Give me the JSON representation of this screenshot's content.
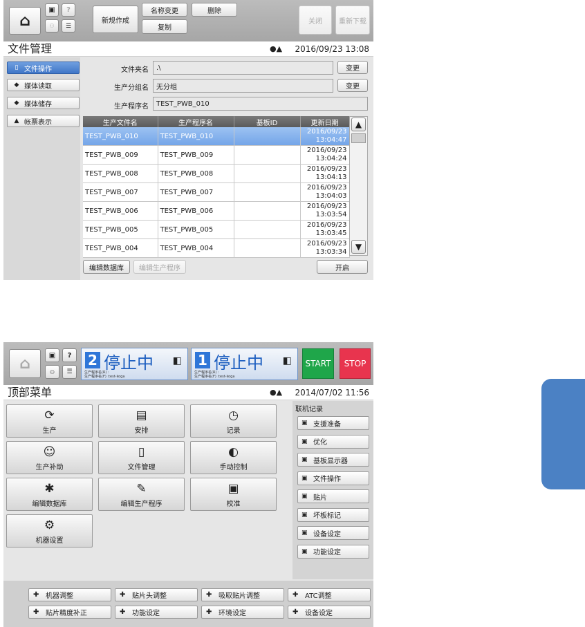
{
  "top": {
    "toolbar": {
      "new_label": "新规作成",
      "rename_label": "名称变更",
      "delete_label": "删除",
      "copy_label": "复制",
      "close_label": "关闭",
      "reload_label": "重新下载",
      "help_glyph": "?"
    },
    "title": "文件管理",
    "datetime": "2016/09/23 13:08",
    "sidebar": [
      {
        "label": "文件操作",
        "icon": "file-op-icon",
        "active": true
      },
      {
        "label": "媒体读取",
        "icon": "media-read-icon",
        "active": false
      },
      {
        "label": "媒体储存",
        "icon": "media-save-icon",
        "active": false
      },
      {
        "label": "帐票表示",
        "icon": "report-icon",
        "active": false
      }
    ],
    "fields": {
      "folder_label": "文件夹名",
      "folder_value": ".\\",
      "group_label": "生产分组名",
      "group_value": "无分组",
      "program_label": "生产程序名",
      "program_value": "TEST_PWB_010",
      "change_label": "变更"
    },
    "table": {
      "headers": [
        "生产文件名",
        "生产程序名",
        "基板ID",
        "更新日期"
      ],
      "rows": [
        {
          "file": "TEST_PWB_010",
          "program": "TEST_PWB_010",
          "board": "",
          "date": "2016/09/23",
          "time": "13:04:47"
        },
        {
          "file": "TEST_PWB_009",
          "program": "TEST_PWB_009",
          "board": "",
          "date": "2016/09/23",
          "time": "13:04:24"
        },
        {
          "file": "TEST_PWB_008",
          "program": "TEST_PWB_008",
          "board": "",
          "date": "2016/09/23",
          "time": "13:04:13"
        },
        {
          "file": "TEST_PWB_007",
          "program": "TEST_PWB_007",
          "board": "",
          "date": "2016/09/23",
          "time": "13:04:03"
        },
        {
          "file": "TEST_PWB_006",
          "program": "TEST_PWB_006",
          "board": "",
          "date": "2016/09/23",
          "time": "13:03:54"
        },
        {
          "file": "TEST_PWB_005",
          "program": "TEST_PWB_005",
          "board": "",
          "date": "2016/09/23",
          "time": "13:03:45"
        },
        {
          "file": "TEST_PWB_004",
          "program": "TEST_PWB_004",
          "board": "",
          "date": "2016/09/23",
          "time": "13:03:34"
        }
      ]
    },
    "bottom_buttons": {
      "edit_db": "编辑数据库",
      "edit_program": "编辑生产程序",
      "open": "开启"
    }
  },
  "bottom": {
    "status": [
      {
        "num": "2",
        "text": "停止中",
        "sub1": "生产程序名(R) :",
        "sub2": "生产程序名(F) :test-koga"
      },
      {
        "num": "1",
        "text": "停止中",
        "sub1": "生产程序名(R) :",
        "sub2": "生产程序名(F) :test-koga"
      }
    ],
    "start_label": "START",
    "stop_label": "STOP",
    "help_glyph": "?",
    "title": "顶部菜单",
    "datetime": "2014/07/02 11:56",
    "menu": [
      {
        "label": "生产",
        "icon": "auto-icon",
        "glyph": "⟳"
      },
      {
        "label": "安排",
        "icon": "schedule-icon",
        "glyph": "▤"
      },
      {
        "label": "记录",
        "icon": "history-icon",
        "glyph": "◷"
      },
      {
        "label": "生产补助",
        "icon": "support-icon",
        "glyph": "☺"
      },
      {
        "label": "文件管理",
        "icon": "file-icon",
        "glyph": "▯"
      },
      {
        "label": "手动控制",
        "icon": "manual-icon",
        "glyph": "◐"
      },
      {
        "label": "编辑数据库",
        "icon": "database-icon",
        "glyph": "✱"
      },
      {
        "label": "编辑生产程序",
        "icon": "program-icon",
        "glyph": "✎"
      },
      {
        "label": "校准",
        "icon": "calibration-icon",
        "glyph": "▣"
      },
      {
        "label": "机器设置",
        "icon": "machine-settings-icon",
        "glyph": "⚙"
      }
    ],
    "records_label": "联机记录",
    "records": [
      {
        "label": "支援准备",
        "icon": "prep-icon"
      },
      {
        "label": "优化",
        "icon": "optimize-icon"
      },
      {
        "label": "基板显示器",
        "icon": "board-display-icon"
      },
      {
        "label": "文件操作",
        "icon": "file-op-icon"
      },
      {
        "label": "贴片",
        "icon": "mount-icon"
      },
      {
        "label": "坏板标记",
        "icon": "bad-mark-icon"
      },
      {
        "label": "设备设定",
        "icon": "device-settings-icon"
      },
      {
        "label": "功能设定",
        "icon": "function-settings-icon"
      }
    ],
    "footer": [
      {
        "label": "机器调整",
        "icon": "machine-adjust-icon"
      },
      {
        "label": "贴片头调整",
        "icon": "head-adjust-icon"
      },
      {
        "label": "吸取贴片调整",
        "icon": "pickup-adjust-icon"
      },
      {
        "label": "ATC调整",
        "icon": "atc-adjust-icon"
      },
      {
        "label": "贴片精度补正",
        "icon": "accuracy-icon"
      },
      {
        "label": "功能设定",
        "icon": "function-settings-icon"
      },
      {
        "label": "环境设定",
        "icon": "environment-icon"
      },
      {
        "label": "设备设定",
        "icon": "device-settings-icon"
      }
    ]
  },
  "colors": {
    "accent": "#4b81c4",
    "start": "#1fa64a",
    "stop": "#e8344e",
    "status_blue": "#2e76d8"
  }
}
